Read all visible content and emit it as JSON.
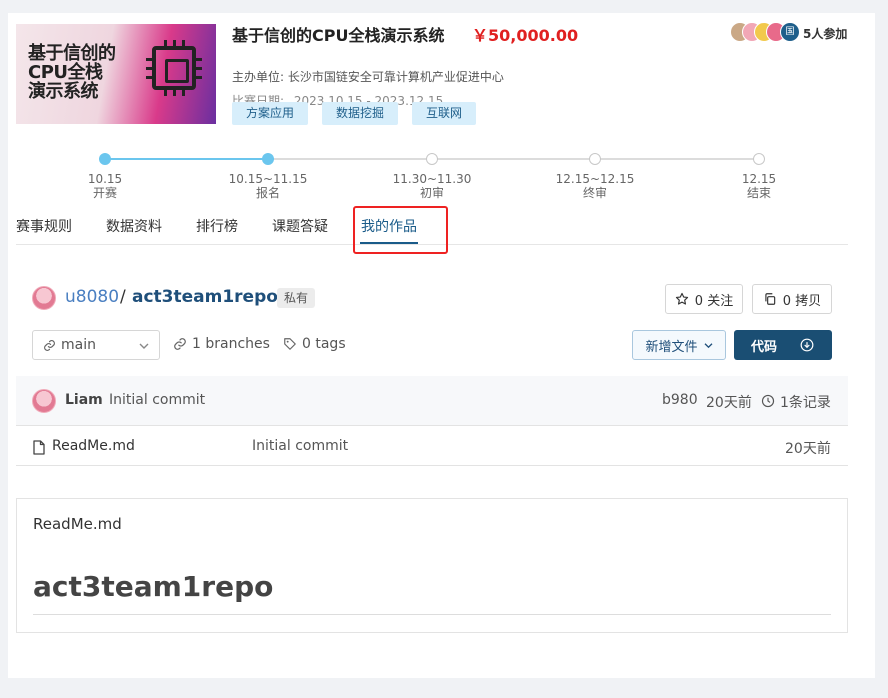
{
  "competition": {
    "banner_text": [
      "基于信创的",
      "CPU全栈",
      "演示系统"
    ],
    "title": "基于信创的CPU全栈演示系统",
    "prize": "￥50,000.00",
    "organizer_label": "主办单位: ",
    "organizer": "长沙市国链安全可靠计算机产业促进中心",
    "date_label": "比赛日期: ",
    "date_range": "2023.10.15 - 2023.12.15",
    "tags": [
      "方案应用",
      "数据挖掘",
      "互联网"
    ],
    "participants": "5人参加",
    "avatar_text": "国"
  },
  "timeline": [
    {
      "date": "10.15",
      "label": "开赛",
      "done": true
    },
    {
      "date": "10.15~11.15",
      "label": "报名",
      "done": true
    },
    {
      "date": "11.30~11.30",
      "label": "初审",
      "done": false
    },
    {
      "date": "12.15~12.15",
      "label": "终审",
      "done": false
    },
    {
      "date": "12.15",
      "label": "结束",
      "done": false
    }
  ],
  "tabs": [
    {
      "label": "赛事规则"
    },
    {
      "label": "数据资料"
    },
    {
      "label": "排行榜"
    },
    {
      "label": "课题答疑"
    },
    {
      "label": "我的作品",
      "active": true
    }
  ],
  "repo": {
    "owner": "u8080",
    "separator": "/",
    "name": "act3team1repo",
    "visibility": "私有",
    "watch": "0 关注",
    "fork": "0 拷贝",
    "branch": "main",
    "branches": "1 branches",
    "tags": "0 tags",
    "new_file": "新增文件",
    "code": "代码"
  },
  "commit": {
    "author": "Liam",
    "message": "Initial commit",
    "hash": "b980",
    "time": "20天前",
    "count": "1条记录"
  },
  "files": [
    {
      "name": "ReadMe.md",
      "message": "Initial commit",
      "time": "20天前"
    }
  ],
  "readme": {
    "filename": "ReadMe.md",
    "heading": "act3team1repo"
  },
  "colors": {
    "accent": "#1a5b89",
    "prize": "#e02020",
    "timeline_done": "#6bc6ee",
    "highlight": "#e22222"
  }
}
